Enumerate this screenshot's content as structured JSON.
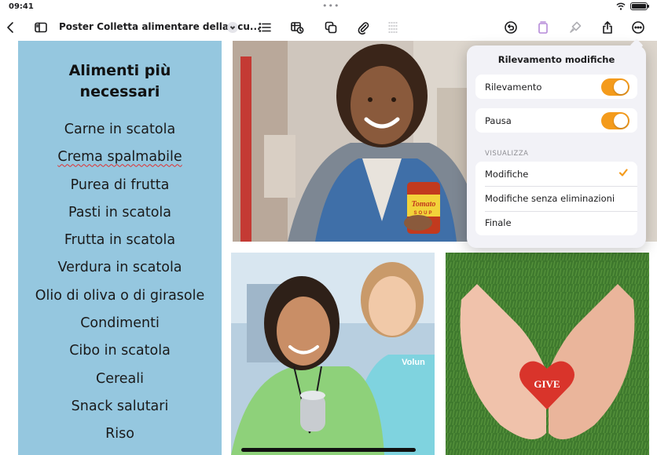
{
  "status_bar": {
    "time": "09:41",
    "dots": "•••"
  },
  "toolbar": {
    "doc_title": "Poster Colletta alimentare della scu..."
  },
  "poster": {
    "title_line1": "Alimenti più",
    "title_line2": "necessari",
    "items": [
      "Carne in scatola",
      "Crema spalmabile",
      "Purea di frutta",
      "Pasti in scatola",
      "Frutta in scatola",
      "Verdura in scatola",
      "Olio di oliva o di girasole",
      "Condimenti",
      "Cibo in scatola",
      "Cereali",
      "Snack salutari",
      "Riso"
    ],
    "can_label": "Tomato",
    "can_sublabel": "SOUP",
    "shirt_text": "Volun",
    "heart_text": "GIVE"
  },
  "popover": {
    "title": "Rilevamento modifiche",
    "tracking_label": "Rilevamento",
    "tracking_on": true,
    "pause_label": "Pausa",
    "pause_on": true,
    "view_section": "VISUALIZZA",
    "view_options": [
      "Modifiche",
      "Modifiche senza eliminazioni",
      "Finale"
    ],
    "selected_view": "Modifiche"
  },
  "colors": {
    "accent": "#f49b1c",
    "panel": "#95c7df"
  }
}
